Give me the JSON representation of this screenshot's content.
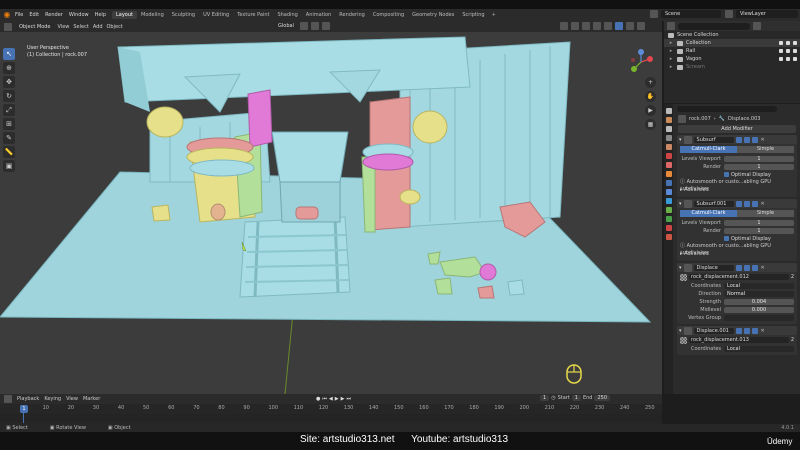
{
  "menu": [
    "File",
    "Edit",
    "Render",
    "Window",
    "Help"
  ],
  "workspace_tabs": [
    "Layout",
    "Modeling",
    "Sculpting",
    "UV Editing",
    "Texture Paint",
    "Shading",
    "Animation",
    "Rendering",
    "Compositing",
    "Geometry Nodes",
    "Scripting"
  ],
  "active_workspace": "Layout",
  "scene_name": "Scene",
  "view_layer": "ViewLayer",
  "viewport": {
    "mode": "Object Mode",
    "menus": [
      "View",
      "Select",
      "Add",
      "Object"
    ],
    "transform_orientation": "Global",
    "view_name": "User Perspective",
    "active_object_info": "(1) Collection | rock.007"
  },
  "outliner": {
    "rows": [
      {
        "label": "Scene Collection"
      },
      {
        "label": "Collection"
      },
      {
        "label": "Rail"
      },
      {
        "label": "Vagon"
      },
      {
        "label": "Scream"
      }
    ]
  },
  "properties": {
    "breadcrumb_object": "rock.007",
    "breadcrumb_modifier": "Displace.003",
    "add_modifier": "Add Modifier",
    "subsurf1": {
      "name": "Subsurf",
      "tab_a": "Catmull-Clark",
      "tab_b": "Simple",
      "levels_viewport_label": "Levels Viewport",
      "levels_viewport": "1",
      "render_label": "Render",
      "render": "1",
      "optimal_display": "Optimal Display",
      "note": "Autosmooth or custo...abling GPU subdivision",
      "advanced": "Advanced"
    },
    "subsurf2": {
      "name": "Subsurf.001",
      "tab_a": "Catmull-Clark",
      "tab_b": "Simple",
      "levels_viewport_label": "Levels Viewport",
      "levels_viewport": "1",
      "render_label": "Render",
      "render": "1",
      "optimal_display": "Optimal Display",
      "note": "Autosmooth or custo...abling GPU subdivision",
      "advanced": "Advanced"
    },
    "displace1": {
      "name": "Displace",
      "texture": "rock_displacement.012",
      "texture_users": "2",
      "coordinates_label": "Coordinates",
      "coordinates": "Local",
      "direction_label": "Direction",
      "direction": "Normal",
      "strength_label": "Strength",
      "strength": "0.004",
      "midlevel_label": "Midlevel",
      "midlevel": "0.000",
      "vertex_group_label": "Vertex Group"
    },
    "displace2": {
      "name": "Displace.001",
      "texture": "rock_displacement.013",
      "texture_users": "2",
      "coordinates_label": "Coordinates",
      "coordinates": "Local"
    }
  },
  "timeline": {
    "menus": [
      "Playback",
      "Keying",
      "View",
      "Marker"
    ],
    "current_frame": "1",
    "start_label": "Start",
    "start": "1",
    "end_label": "End",
    "end": "250",
    "ticks": [
      "1",
      "10",
      "20",
      "30",
      "40",
      "50",
      "60",
      "70",
      "80",
      "90",
      "100",
      "110",
      "120",
      "130",
      "140",
      "150",
      "160",
      "170",
      "180",
      "190",
      "200",
      "210",
      "220",
      "230",
      "240",
      "250"
    ]
  },
  "status_bar": {
    "items": [
      "Select",
      "Rotate View",
      "Object"
    ],
    "version": "4.0.1"
  },
  "watermark": {
    "site": "Site: artstudio313.net",
    "youtube": "Youtube: artstudio313",
    "brand": "Ūdemy"
  },
  "colors": {
    "accent": "#4772b3",
    "floor": "#9fd4dc",
    "pillar_pink": "#e59a9a",
    "pillar_yellow": "#e6e08a",
    "pillar_green": "#b2e09a",
    "magenta": "#e07ad6"
  }
}
